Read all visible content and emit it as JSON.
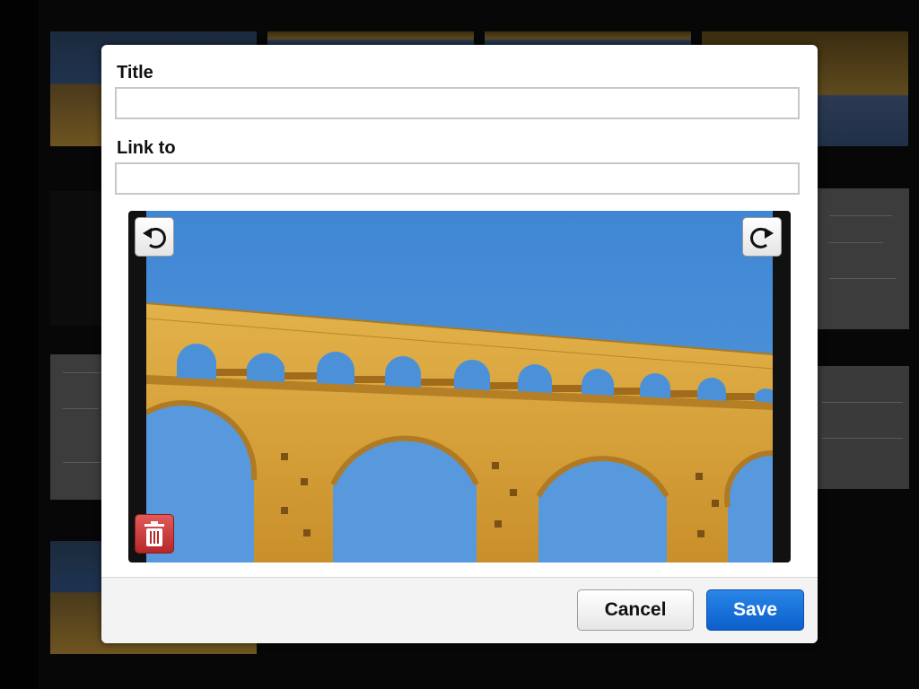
{
  "dialog": {
    "title_label": "Title",
    "title_value": "",
    "link_label": "Link to",
    "link_value": "",
    "cancel_label": "Cancel",
    "save_label": "Save"
  },
  "image_editor": {
    "photo_subject": "stone aqueduct arches against blue sky",
    "rotate_left_icon": "rotate-left-icon",
    "rotate_right_icon": "rotate-right-icon",
    "delete_icon": "trash-icon"
  },
  "colors": {
    "save_button": "#0b5fcc",
    "delete_button": "#b72828",
    "sky": "#4c91d8",
    "stone": "#d9a53c"
  }
}
